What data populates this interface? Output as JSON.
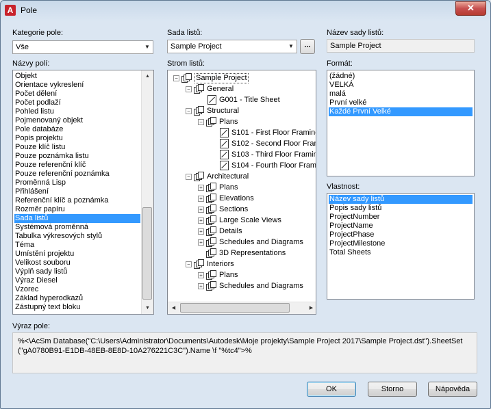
{
  "window": {
    "title": "Pole",
    "close": "✕",
    "app_letter": "A"
  },
  "kategorie": {
    "label": "Kategorie pole:",
    "value": "Vše"
  },
  "nazvy_poli": {
    "label": "Názvy polí:",
    "items": [
      "Objekt",
      "Orientace vykreslení",
      "Počet dělení",
      "Počet podlaží",
      "Pohled listu",
      "Pojmenovaný objekt",
      "Pole databáze",
      "Popis projektu",
      "Pouze klíč listu",
      "Pouze poznámka listu",
      "Pouze referenční klíč",
      "Pouze referenční poznámka",
      "Proměnná Lisp",
      "Přihlášení",
      "Referenční klíč a poznámka",
      "Rozměr papíru",
      "Sada listů",
      "Systémová proměnná",
      "Tabulka výkresových stylů",
      "Téma",
      "Umístění projektu",
      "Velikost souboru",
      "Výplň sady listů",
      "Výraz Diesel",
      "Vzorec",
      "Základ hyperodkazů",
      "Zástupný text bloku"
    ],
    "selected_index": 16
  },
  "sada_listu": {
    "label": "Sada listů:",
    "value": "Sample Project",
    "browse": "..."
  },
  "strom_listu": {
    "label": "Strom listů:",
    "rows": [
      {
        "text": "Sample Project",
        "level": 0,
        "exp": "−",
        "icon": "set",
        "boxed": true
      },
      {
        "text": "General",
        "level": 1,
        "exp": "−",
        "icon": "subset"
      },
      {
        "text": "G001 - Title Sheet",
        "level": 2,
        "exp": "",
        "icon": "sheet"
      },
      {
        "text": "Structural",
        "level": 1,
        "exp": "−",
        "icon": "subset"
      },
      {
        "text": "Plans",
        "level": 2,
        "exp": "−",
        "icon": "subset"
      },
      {
        "text": "S101 - First Floor Framing",
        "level": 3,
        "exp": "",
        "icon": "sheet"
      },
      {
        "text": "S102 - Second Floor Framing",
        "level": 3,
        "exp": "",
        "icon": "sheet"
      },
      {
        "text": "S103 - Third Floor Framing",
        "level": 3,
        "exp": "",
        "icon": "sheet"
      },
      {
        "text": "S104 - Fourth Floor Framing",
        "level": 3,
        "exp": "",
        "icon": "sheet"
      },
      {
        "text": "Architectural",
        "level": 1,
        "exp": "−",
        "icon": "subset"
      },
      {
        "text": "Plans",
        "level": 2,
        "exp": "+",
        "icon": "subset"
      },
      {
        "text": "Elevations",
        "level": 2,
        "exp": "+",
        "icon": "subset"
      },
      {
        "text": "Sections",
        "level": 2,
        "exp": "+",
        "icon": "subset"
      },
      {
        "text": "Large Scale Views",
        "level": 2,
        "exp": "+",
        "icon": "subset"
      },
      {
        "text": "Details",
        "level": 2,
        "exp": "+",
        "icon": "subset"
      },
      {
        "text": "Schedules and Diagrams",
        "level": 2,
        "exp": "+",
        "icon": "subset"
      },
      {
        "text": "3D Representations",
        "level": 2,
        "exp": "",
        "icon": "subset"
      },
      {
        "text": "Interiors",
        "level": 1,
        "exp": "−",
        "icon": "subset"
      },
      {
        "text": "Plans",
        "level": 2,
        "exp": "+",
        "icon": "subset"
      },
      {
        "text": "Schedules and Diagrams",
        "level": 2,
        "exp": "+",
        "icon": "subset"
      }
    ]
  },
  "nazev_sady": {
    "label": "Název sady listů:",
    "value": "Sample Project"
  },
  "format": {
    "label": "Formát:",
    "items": [
      "(žádné)",
      "VELKÁ",
      "malá",
      "První velké",
      "Každé První Velké"
    ],
    "selected_index": 4
  },
  "vlastnost": {
    "label": "Vlastnost:",
    "items": [
      "Název sady listů",
      "Popis sady listů",
      "ProjectNumber",
      "ProjectName",
      "ProjectPhase",
      "ProjectMilestone",
      "Total Sheets"
    ],
    "selected_index": 0
  },
  "vyraz": {
    "label": "Výraz pole:",
    "line1": "%<\\AcSm Database(\"C:\\Users\\Administrator\\Documents\\Autodesk\\Moje projekty\\Sample Project 2017\\Sample Project.dst\").SheetSet",
    "line2": "(\"gA0780B91-E1DB-48EB-8E8D-10A276221C3C\").Name \\f \"%tc4\">%"
  },
  "buttons": {
    "ok": "OK",
    "cancel": "Storno",
    "help": "Nápověda"
  }
}
